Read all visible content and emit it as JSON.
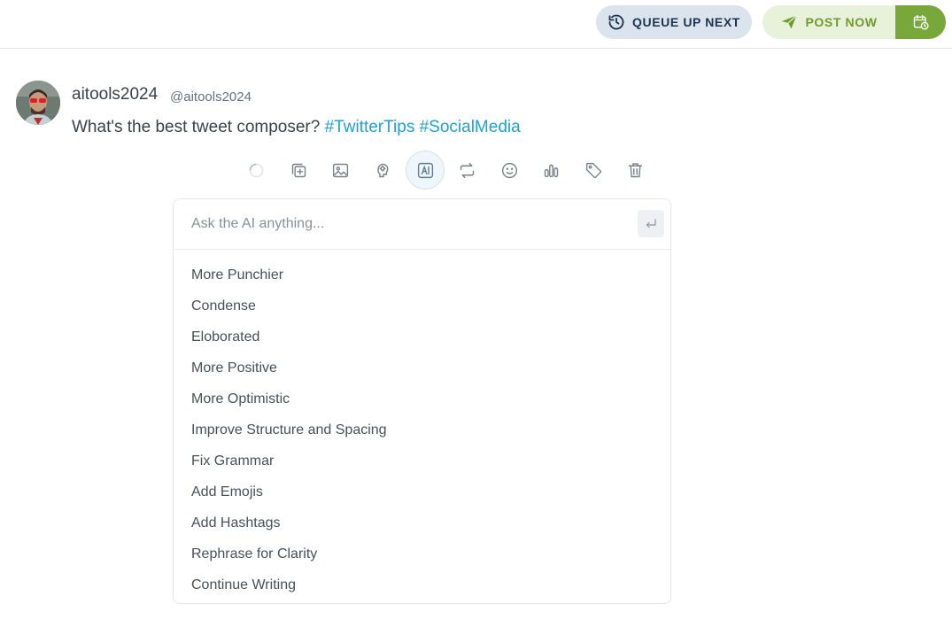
{
  "header": {
    "queue_label": "QUEUE UP NEXT",
    "post_label": "POST NOW"
  },
  "tweet": {
    "username": "aitools2024",
    "handle": "@aitools2024",
    "text": "What's the best tweet composer?",
    "hashtags": [
      "#TwitterTips",
      "#SocialMedia"
    ]
  },
  "toolbar": {
    "icons": [
      "loading-spinner-icon",
      "add-thread-icon",
      "image-icon",
      "brain-icon",
      "ai-icon",
      "retweet-icon",
      "emoji-icon",
      "poll-icon",
      "tag-icon",
      "trash-icon"
    ],
    "active": "ai-icon"
  },
  "ai_panel": {
    "placeholder": "Ask the AI anything...",
    "options": [
      "More Punchier",
      "Condense",
      "Eloborated",
      "More Positive",
      "More Optimistic",
      "Improve Structure and Spacing",
      "Fix Grammar",
      "Add Emojis",
      "Add Hashtags",
      "Rephrase for Clarity",
      "Continue Writing"
    ]
  },
  "colors": {
    "accent_green": "#79a83a",
    "hashtag_blue": "#1ea2d6",
    "queue_bg": "#dbe3ec"
  }
}
